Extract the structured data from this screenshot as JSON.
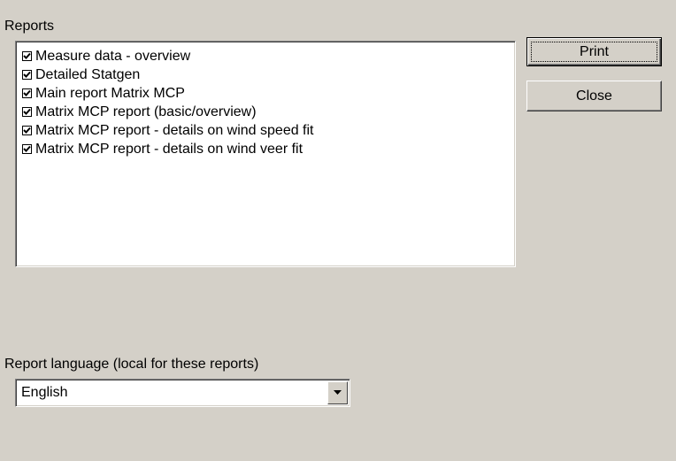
{
  "reports": {
    "label": "Reports",
    "items": [
      {
        "label": "Measure data - overview",
        "checked": true
      },
      {
        "label": "Detailed Statgen",
        "checked": true
      },
      {
        "label": "Main report Matrix MCP",
        "checked": true
      },
      {
        "label": "Matrix MCP report (basic/overview)",
        "checked": true
      },
      {
        "label": "Matrix MCP report - details on wind speed fit",
        "checked": true
      },
      {
        "label": "Matrix MCP report - details on wind veer fit",
        "checked": true
      }
    ]
  },
  "buttons": {
    "print_label": "Print",
    "close_label": "Close"
  },
  "language": {
    "label": "Report language (local for these reports)",
    "selected": "English"
  }
}
